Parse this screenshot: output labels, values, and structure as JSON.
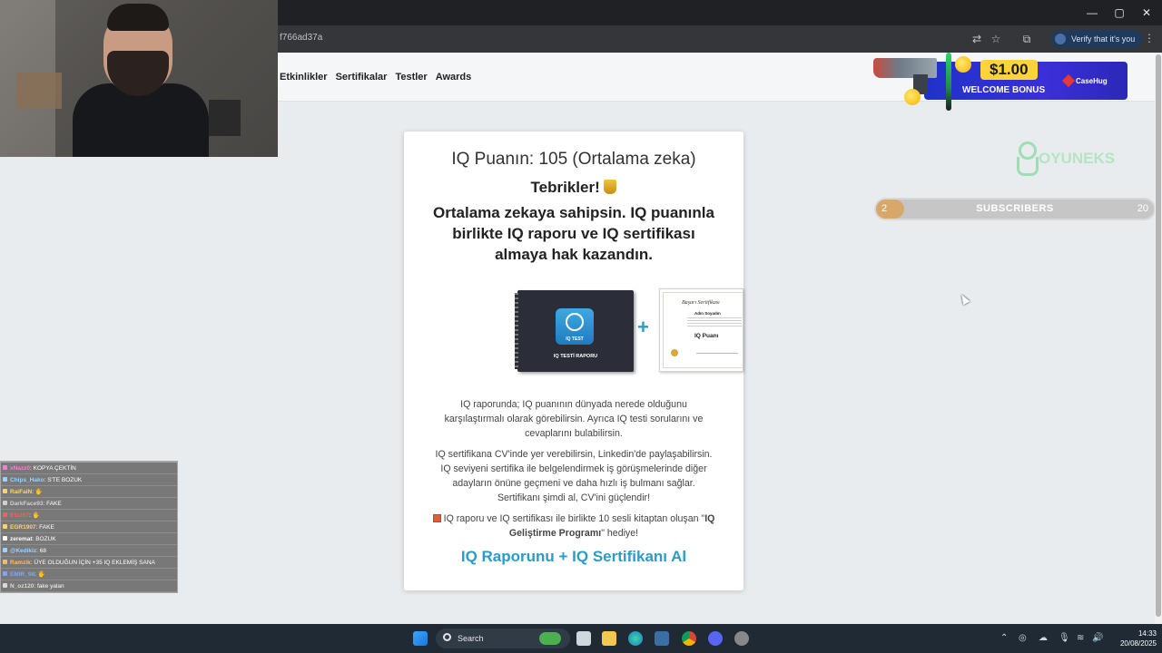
{
  "browser": {
    "url_fragment": "f766ad37a",
    "verify_label": "Verify that it's you",
    "window_controls": [
      "—",
      "▢",
      "✕"
    ]
  },
  "site": {
    "nav": [
      "Etkinlikler",
      "Sertifikalar",
      "Testler",
      "Awards"
    ]
  },
  "ad": {
    "price": "$1.00",
    "bonus": "WELCOME BONUS",
    "brand": "CaseHug"
  },
  "sidebar_logo": "OYUNEKS",
  "subscribers": {
    "current": "2",
    "label": "SUBSCRIBERS",
    "goal": "20",
    "progress_fraction": 0.1
  },
  "card": {
    "title": "IQ Puanın: 105 (Ortalama zeka)",
    "congrats": "Tebrikler!",
    "headline": "Ortalama zekaya sahipsin. IQ puanınla birlikte IQ raporu ve IQ sertifikası almaya hak kazandın.",
    "book_brand": "IQ TEST",
    "book_label": "IQ TESTİ RAPORU",
    "cert_title": "Başarı Sertifikası",
    "cert_name": "Adın Soyadın",
    "cert_score": "IQ Puanı",
    "para1": "IQ raporunda; IQ puanının dünyada nerede olduğunu karşılaştırmalı olarak görebilirsin. Ayrıca IQ testi sorularını ve cevaplarını bulabilirsin.",
    "para2": "IQ sertifikana CV'inde yer verebilirsin, Linkedin'de paylaşabilirsin. IQ seviyeni sertifika ile belgelendirmek iş görüşmelerinde diğer adayların önüne geçmeni ve daha hızlı iş bulmanı sağlar. Sertifikanı şimdi al, CV'ini güçlendir!",
    "para3_pre": "IQ raporu ve IQ sertifikası ile birlikte 10 sesli kitaptan oluşan \"",
    "para3_bold": "IQ Geliştirme Programı",
    "para3_post": "\" hediye!",
    "cta": "IQ Raporunu + IQ Sertifikanı Al"
  },
  "chat": [
    {
      "user": "xNazz0",
      "msg": ": KOPYA ÇEKTİN",
      "color": "#ff7ad9"
    },
    {
      "user": "Chips_Hako",
      "msg": ": S'TE BOZUK",
      "color": "#9ad3ff"
    },
    {
      "user": "RaiFaiN",
      "msg": ": 🖐",
      "color": "#ffd36b"
    },
    {
      "user": "DarkFace93",
      "msg": ": FAKE",
      "color": "#cfcfcf"
    },
    {
      "user": "Efe267",
      "msg": ": 🖐",
      "color": "#ff5c5c"
    },
    {
      "user": "EGR1907",
      "msg": ": FAKE",
      "color": "#ffd36b"
    },
    {
      "user": "zeremat",
      "msg": ": BOZUK",
      "color": "#ffffff"
    },
    {
      "user": "@Kedikiz",
      "msg": ": 68",
      "color": "#9ad3ff"
    },
    {
      "user": "Ramzik",
      "msg": ": ÜYE OLDUĞUN İÇİN +35 IQ EKLEMİŞ SANA",
      "color": "#ffb86b"
    },
    {
      "user": "EMIR_98",
      "msg": ": 🖐",
      "color": "#7aa6ff"
    },
    {
      "user": "N_oz120",
      "msg": ": fake yalan",
      "color": "#d9d9d9"
    }
  ],
  "taskbar": {
    "search": "Search",
    "time": "14:33",
    "date": "20/08/2025"
  },
  "colors": {
    "accent": "#2a9cc7",
    "taskbar": "#1f2a35"
  }
}
